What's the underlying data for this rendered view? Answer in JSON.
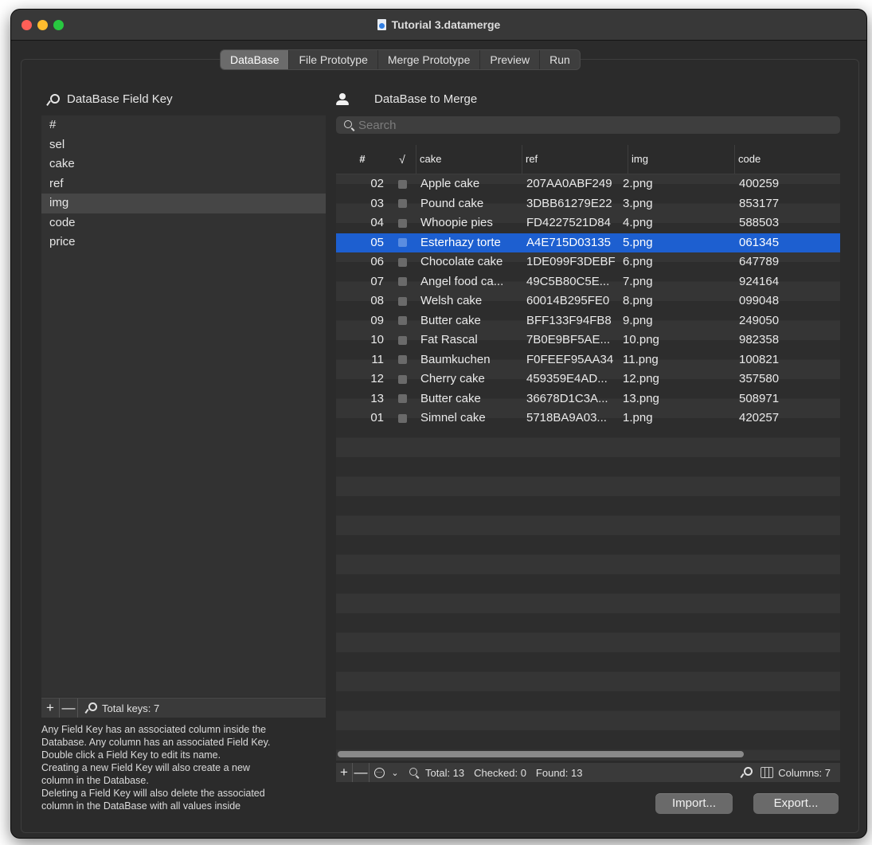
{
  "window": {
    "title": "Tutorial 3.datamerge"
  },
  "tabs": [
    {
      "label": "DataBase",
      "active": true
    },
    {
      "label": "File Prototype"
    },
    {
      "label": "Merge Prototype"
    },
    {
      "label": "Preview"
    },
    {
      "label": "Run"
    }
  ],
  "left": {
    "header": "DataBase Field Key",
    "fields": [
      "#",
      "sel",
      "cake",
      "ref",
      "img",
      "code",
      "price"
    ],
    "selected_field": "img",
    "add_label": "+",
    "remove_label": "—",
    "total_keys": "Total keys: 7",
    "help_lines": [
      "Any Field Key has an associated column inside the",
      "Database. Any column has an associated Field Key.",
      "Double click a Field Key to edit its name.",
      "Creating a new Field Key will also create a new",
      "column in the Database.",
      "Deleting a Field Key will also delete the associated",
      "column in the DataBase with all values inside"
    ]
  },
  "right": {
    "header": "DataBase to Merge",
    "search_placeholder": "Search",
    "columns": [
      "#",
      "√",
      "cake",
      "ref",
      "img",
      "code"
    ],
    "rows": [
      {
        "num": "02",
        "cake": "Apple cake",
        "ref": "207AA0ABF249",
        "img": "2.png",
        "code": "400259"
      },
      {
        "num": "03",
        "cake": "Pound cake",
        "ref": "3DBB61279E22",
        "img": "3.png",
        "code": "853177"
      },
      {
        "num": "04",
        "cake": "Whoopie pies",
        "ref": "FD4227521D84",
        "img": "4.png",
        "code": "588503"
      },
      {
        "num": "05",
        "cake": "Esterhazy torte",
        "ref": "A4E715D03135",
        "img": "5.png",
        "code": "061345",
        "selected": true
      },
      {
        "num": "06",
        "cake": "Chocolate cake",
        "ref": "1DE099F3DEBF",
        "img": "6.png",
        "code": "647789"
      },
      {
        "num": "07",
        "cake": "Angel food ca...",
        "ref": "49C5B80C5E...",
        "img": "7.png",
        "code": "924164"
      },
      {
        "num": "08",
        "cake": "Welsh cake",
        "ref": "60014B295FE0",
        "img": "8.png",
        "code": "099048"
      },
      {
        "num": "09",
        "cake": "Butter cake",
        "ref": "BFF133F94FB8",
        "img": "9.png",
        "code": "249050"
      },
      {
        "num": "10",
        "cake": "Fat Rascal",
        "ref": "7B0E9BF5AE...",
        "img": "10.png",
        "code": "982358"
      },
      {
        "num": "11",
        "cake": "Baumkuchen",
        "ref": "F0FEEF95AA34",
        "img": "11.png",
        "code": "100821"
      },
      {
        "num": "12",
        "cake": "Cherry cake",
        "ref": "459359E4AD...",
        "img": "12.png",
        "code": "357580"
      },
      {
        "num": "13",
        "cake": "Butter cake",
        "ref": "36678D1C3A...",
        "img": "13.png",
        "code": "508971"
      },
      {
        "num": "01",
        "cake": "Simnel cake",
        "ref": "5718BA9A03...",
        "img": "1.png",
        "code": "420257"
      }
    ],
    "footer": {
      "add_label": "+",
      "remove_label": "—",
      "more_label": "···",
      "chevron_label": "⌄",
      "total": "Total: 13",
      "checked": "Checked: 0",
      "found": "Found: 13",
      "columns": "Columns: 7"
    }
  },
  "buttons": {
    "import": "Import...",
    "export": "Export..."
  },
  "colors": {
    "selection": "#1d5fd0",
    "background": "#2b2b2b"
  }
}
